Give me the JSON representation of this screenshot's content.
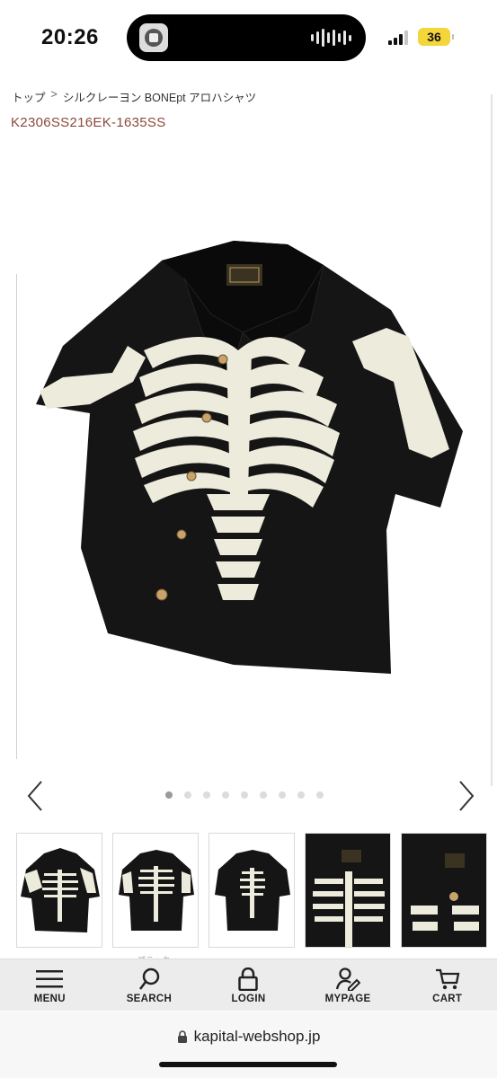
{
  "status_bar": {
    "time": "20:26",
    "battery": "36",
    "signal_icon": "cellular-signal-icon"
  },
  "breadcrumb": {
    "home": "トップ",
    "separator": ">",
    "current": "シルクレーヨン BONEpt アロハシャツ"
  },
  "product": {
    "code": "K2306SS216EK-1635SS",
    "image_icon": "skeleton-print-shirt-image"
  },
  "gallery": {
    "prev_icon": "chevron-left-icon",
    "next_icon": "chevron-right-icon",
    "dot_count": 9,
    "active_dot": 0,
    "thumb_label_fragment": "ブラック"
  },
  "bottom_nav": {
    "items": [
      {
        "label": "MENU",
        "icon": "hamburger-icon"
      },
      {
        "label": "SEARCH",
        "icon": "search-icon"
      },
      {
        "label": "LOGIN",
        "icon": "lock-icon"
      },
      {
        "label": "MYPAGE",
        "icon": "user-edit-icon"
      },
      {
        "label": "CART",
        "icon": "cart-icon"
      }
    ]
  },
  "url_bar": {
    "url": "kapital-webshop.jp"
  },
  "colors": {
    "code_text": "#8b4a3b",
    "shirt": "#151515",
    "bones": "#ecebdc",
    "nav_bg": "#ececec",
    "battery": "#f4d53a"
  }
}
